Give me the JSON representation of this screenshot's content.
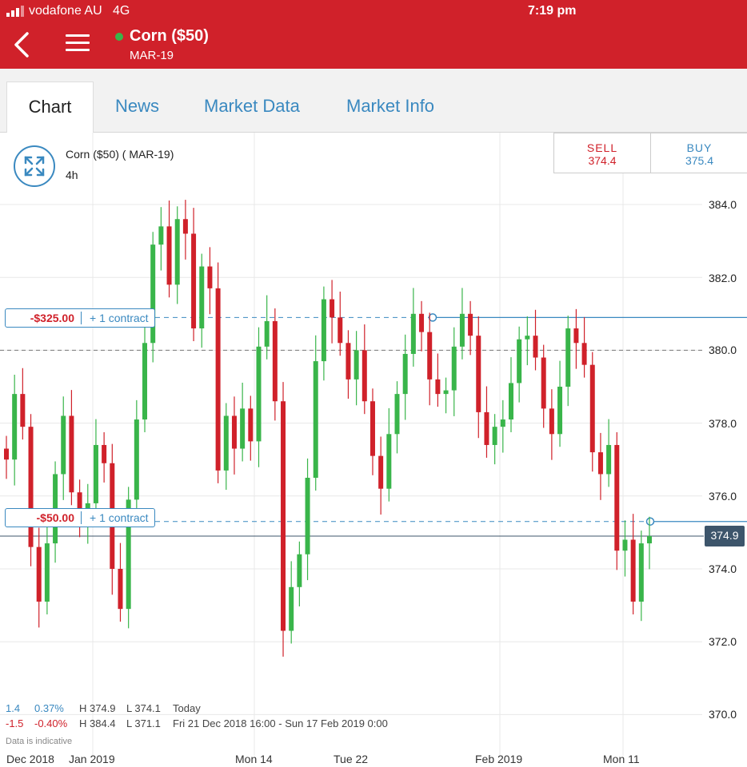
{
  "status_bar": {
    "carrier": "vodafone AU",
    "network": "4G",
    "time": "7:19 pm"
  },
  "header": {
    "title": "Corn ($50)",
    "subtitle": "MAR-19",
    "colors": {
      "bar": "#d0212a",
      "live": "#39b54a"
    }
  },
  "tabs": [
    {
      "label": "Chart",
      "active": true
    },
    {
      "label": "News",
      "active": false
    },
    {
      "label": "Market Data",
      "active": false
    },
    {
      "label": "Market Info",
      "active": false
    }
  ],
  "chart_header": {
    "title": "Corn ($50) ( MAR-19)",
    "interval": "4h"
  },
  "quote": {
    "sell_label": "SELL",
    "sell_value": "374.4",
    "buy_label": "BUY",
    "buy_value": "375.4"
  },
  "positions": [
    {
      "pnl": "-$325.00",
      "qty": "+ 1 contract",
      "price": 380.9
    },
    {
      "pnl": "-$50.00",
      "qty": "+ 1 contract",
      "price": 375.3
    }
  ],
  "current_price": "374.9",
  "stats": {
    "today": {
      "change": "1.4",
      "pct": "0.37%",
      "high": "H 374.9",
      "low": "L 374.1",
      "period": "Today"
    },
    "range": {
      "change": "-1.5",
      "pct": "-0.40%",
      "high": "H 384.4",
      "low": "L 371.1",
      "period": "Fri 21 Dec 2018 16:00 - Sun 17 Feb 2019 0:00"
    }
  },
  "note": "Data is indicative",
  "chart_data": {
    "type": "candlestick",
    "title": "Corn ($50) ( MAR-19)",
    "y_ticks": [
      "384.0",
      "382.0",
      "380.0",
      "378.0",
      "376.0",
      "374.0",
      "372.0",
      "370.0"
    ],
    "x_ticks": [
      "Dec 2018",
      "Jan 2019",
      "Mon 14",
      "Tue 22",
      "Feb 2019",
      "Mon 11"
    ],
    "ylim": [
      369.5,
      384.8
    ],
    "reference_price": 380.0,
    "last_price": 374.9,
    "grid": true,
    "colors": {
      "up": "#39b54a",
      "down": "#d0212a",
      "position": "#3a89c0",
      "price_line": "#3d556b"
    },
    "series_close": [
      377.0,
      378.8,
      377.9,
      374.6,
      373.1,
      374.7,
      376.6,
      378.2,
      376.1,
      375.4,
      375.8,
      377.4,
      376.9,
      374.0,
      372.9,
      375.9,
      378.1,
      380.2,
      382.9,
      383.4,
      381.8,
      383.6,
      383.2,
      380.6,
      382.3,
      381.7,
      376.7,
      378.2,
      377.3,
      378.4,
      377.5,
      380.1,
      380.8,
      378.6,
      372.3,
      373.5,
      374.4,
      376.5,
      379.7,
      381.4,
      380.9,
      380.2,
      379.2,
      380.0,
      378.6,
      377.1,
      376.2,
      377.7,
      378.8,
      379.9,
      381.0,
      380.5,
      379.2,
      378.8,
      378.9,
      380.1,
      381.0,
      380.4,
      378.3,
      377.4,
      377.9,
      378.1,
      379.1,
      380.3,
      380.4,
      379.8,
      378.4,
      377.7,
      379.0,
      380.6,
      380.2,
      379.6,
      377.2,
      376.6,
      377.4,
      374.5,
      374.8,
      373.1,
      374.7,
      374.9
    ]
  }
}
